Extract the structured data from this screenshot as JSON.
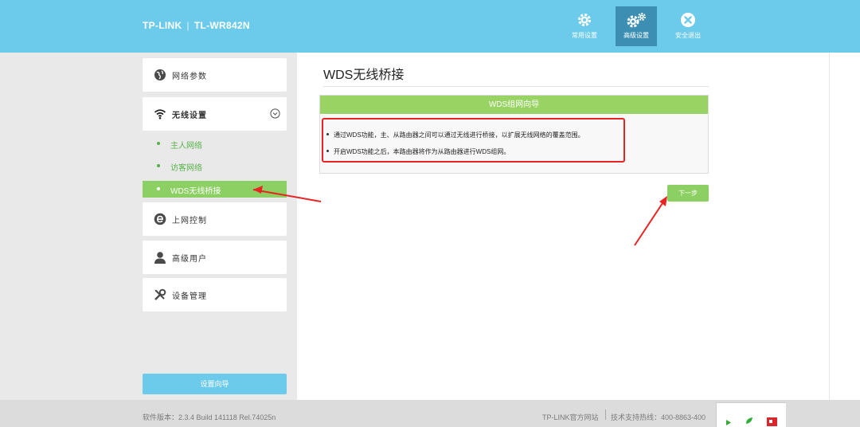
{
  "header": {
    "brand": "TP-LINK",
    "model": "TL-WR842N",
    "nav": [
      {
        "label": "常用设置",
        "icon": "gear-icon"
      },
      {
        "label": "高级设置",
        "icon": "gears-icon"
      },
      {
        "label": "安全退出",
        "icon": "close-circle-icon"
      }
    ]
  },
  "sidebar": {
    "menu": [
      {
        "label": "网络参数",
        "icon": "globe-icon"
      },
      {
        "label": "无线设置",
        "icon": "wifi-icon"
      },
      {
        "label": "上网控制",
        "icon": "internet-e-icon"
      },
      {
        "label": "高级用户",
        "icon": "user-icon"
      },
      {
        "label": "设备管理",
        "icon": "tools-icon"
      }
    ],
    "wireless_sub": [
      "主人网络",
      "访客网络",
      "WDS无线桥接"
    ],
    "wizard_label": "设置向导"
  },
  "main": {
    "title": "WDS无线桥接",
    "panel_title": "WDS组网向导",
    "lines": [
      "通过WDS功能，主、从路由器之间可以通过无线进行桥接，以扩展无线网络的覆盖范围。",
      "开启WDS功能之后，本路由器将作为从路由器进行WDS组网。"
    ],
    "next_label": "下一步"
  },
  "footer": {
    "version": "软件版本：2.3.4 Build 141118 Rel.74025n",
    "site": "TP-LINK官方网站",
    "support": "技术支持热线：400-8863-400"
  },
  "colors": {
    "header": "#6ccbea",
    "green": "#8ccf62",
    "annotation_red": "#e82323"
  }
}
